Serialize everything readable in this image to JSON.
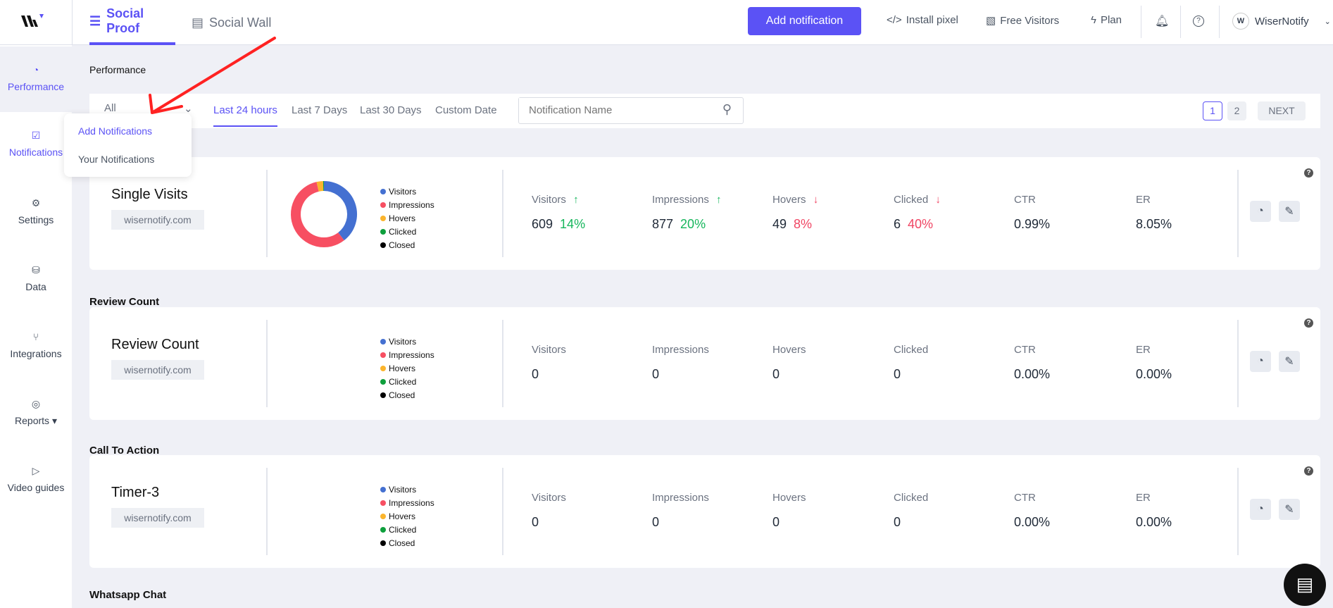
{
  "topbar": {
    "tabs": [
      {
        "label": "Social Proof",
        "icon": "list-icon",
        "active": true
      },
      {
        "label": "Social Wall",
        "icon": "wall-icon"
      }
    ],
    "add_notification": "Add notification",
    "install_pixel": "Install pixel",
    "free_visitors": "Free Visitors",
    "plan": "Plan",
    "account": "WiserNotify",
    "accent": "#5b52f5"
  },
  "sidebar": {
    "items": [
      {
        "label": "Performance"
      },
      {
        "label": "Notifications"
      },
      {
        "label": "Settings"
      },
      {
        "label": "Data"
      },
      {
        "label": "Integrations"
      },
      {
        "label": "Reports ▾"
      },
      {
        "label": "Video guides"
      }
    ]
  },
  "submenu": {
    "items": [
      "Add Notifications",
      "Your Notifications"
    ]
  },
  "page": {
    "title": "Performance"
  },
  "filters": {
    "select": "All",
    "ranges": [
      "Last 24 hours",
      "Last 7 Days",
      "Last 30 Days",
      "Custom Date"
    ],
    "search_placeholder": "Notification Name",
    "pages": [
      "1",
      "2"
    ],
    "next": "NEXT"
  },
  "legend": [
    {
      "label": "Visitors",
      "color": "#4470d1"
    },
    {
      "label": "Impressions",
      "color": "#f74f62"
    },
    {
      "label": "Hovers",
      "color": "#fbb42c"
    },
    {
      "label": "Clicked",
      "color": "#0e9f3c"
    },
    {
      "label": "Closed",
      "color": "#000000"
    }
  ],
  "metric_labels": [
    "Visitors",
    "Impressions",
    "Hovers",
    "Clicked",
    "CTR",
    "ER"
  ],
  "cards": [
    {
      "section": "",
      "title": "Single Visits",
      "domain": "wisernotify.com",
      "values": [
        "609",
        "877",
        "49",
        "6",
        "0.99%",
        "8.05%"
      ],
      "changes": [
        {
          "pct": "14%",
          "dir": "up"
        },
        {
          "pct": "20%",
          "dir": "up"
        },
        {
          "pct": "8%",
          "dir": "down"
        },
        {
          "pct": "40%",
          "dir": "down"
        },
        null,
        null
      ],
      "donut": [
        609,
        877,
        49,
        6,
        0
      ]
    },
    {
      "section": "Review Count",
      "title": "Review Count",
      "domain": "wisernotify.com",
      "values": [
        "0",
        "0",
        "0",
        "0",
        "0.00%",
        "0.00%"
      ],
      "changes": [
        null,
        null,
        null,
        null,
        null,
        null
      ]
    },
    {
      "section": "Call To Action",
      "title": "Timer-3",
      "domain": "wisernotify.com",
      "values": [
        "0",
        "0",
        "0",
        "0",
        "0.00%",
        "0.00%"
      ],
      "changes": [
        null,
        null,
        null,
        null,
        null,
        null
      ]
    }
  ],
  "next_section": "Whatsapp Chat"
}
